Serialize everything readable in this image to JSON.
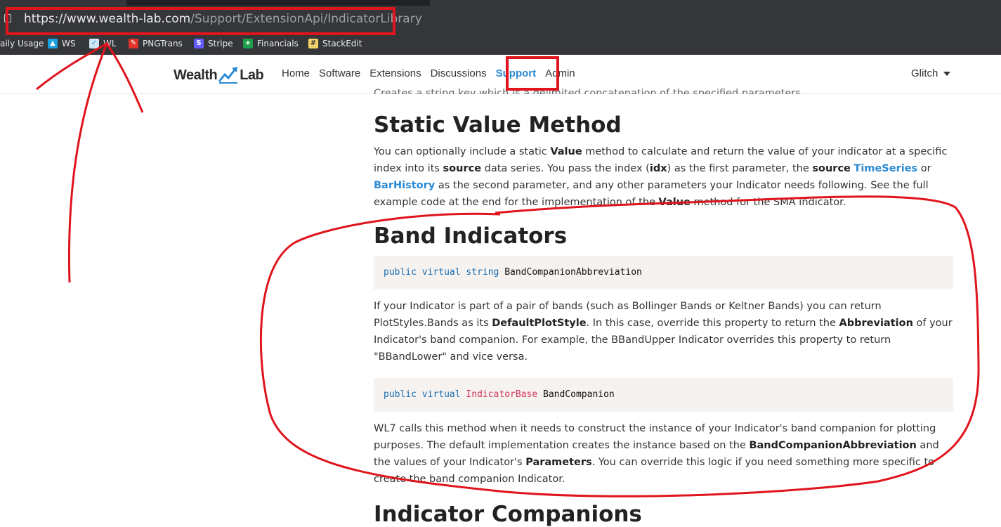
{
  "browser": {
    "url_domain": "https://www.wealth-lab.com",
    "url_path": "/Support/ExtensionApi/IndicatorLibrary",
    "bookmarks": [
      {
        "label": "aily Usage",
        "icon": "folder-icon"
      },
      {
        "label": "WS",
        "icon": "chart-icon"
      },
      {
        "label": "WL",
        "icon": "wl-icon"
      },
      {
        "label": "PNGTrans",
        "icon": "png-icon"
      },
      {
        "label": "Stripe",
        "icon": "stripe-icon"
      },
      {
        "label": "Financials",
        "icon": "sheets-icon"
      },
      {
        "label": "StackEdit",
        "icon": "stackedit-icon"
      }
    ]
  },
  "site": {
    "logo_left": "Wealth",
    "logo_right": "Lab",
    "nav": [
      "Home",
      "Software",
      "Extensions",
      "Discussions",
      "Support",
      "Admin"
    ],
    "active_nav": "Support",
    "user": "Glitch"
  },
  "content": {
    "top_fragment": "Creates a string key which is a delimited concatenation of the specified parameters.",
    "static_heading": "Static Value Method",
    "static_p": {
      "a": "You can optionally include a static ",
      "b": "Value",
      "c": " method to calculate and return the value of your indicator at a specific index into its ",
      "d": "source",
      "e": " data series. You pass the index (",
      "f": "idx",
      "g": ") as the first parameter, the ",
      "h": "source",
      "i": " ",
      "j": "TimeSeries",
      "k": " or ",
      "l": "BarHistory",
      "m": " as the second parameter, and any other parameters your Indicator needs following. See the full example code at the end for the implementation of the ",
      "n": "Value",
      "o": " method for the SMA indicator."
    },
    "band_heading": "Band Indicators",
    "code1": {
      "kw1": "public",
      "kw2": "virtual",
      "kw3": "string",
      "name": "BandCompanionAbbreviation"
    },
    "band_p1": {
      "a": "If your Indicator is part of a pair of bands (such as Bollinger Bands or Keltner Bands) you can return PlotStyles.Bands as its ",
      "b": "DefaultPlotStyle",
      "c": ". In this case, override this property to return the ",
      "d": "Abbreviation",
      "e": " of your Indicator's band companion. For example, the BBandUpper Indicator overrides this property to return \"BBandLower\" and vice versa."
    },
    "code2": {
      "kw1": "public",
      "kw2": "virtual",
      "type": "IndicatorBase",
      "name": "BandCompanion"
    },
    "band_p2": {
      "a": "WL7 calls this method when it needs to construct the instance of your Indicator's band companion for plotting purposes. The default implementation creates the instance based on the ",
      "b": "BandCompanionAbbreviation",
      "c": " and the values of your Indicator's ",
      "d": "Parameters",
      "e": ". You can override this logic if you need something more specific to create the band companion Indicator."
    },
    "companions_heading": "Indicator Companions"
  },
  "colors": {
    "annotation": "#e0141c",
    "link": "#2a8ad4",
    "code_bg": "#f5f2f0"
  }
}
